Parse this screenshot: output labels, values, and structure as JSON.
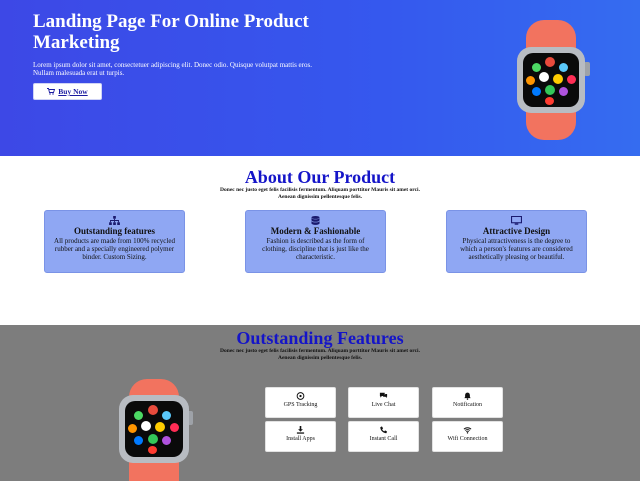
{
  "hero": {
    "title": "Landing Page For Online Product Marketing",
    "text": "Lorem ipsum dolor sit amet, consectetuer adipiscing elit. Donec odio. Quisque volutpat mattis eros. Nullam malesuada erat ut turpis.",
    "buy_label": "Buy Now",
    "buy_icon": "cart-icon"
  },
  "about": {
    "title": "About Our Product",
    "subtitle": "Donec nec justo eget felis facilisis fermentum. Aliquam porttitor Mauris sit amet orci. Aenean dignissim pellentesque felis.",
    "cards": [
      {
        "icon": "sitemap-icon",
        "title": "Outstanding features",
        "text": "All products are made from 100% recycled rubber and a specially engineered polymer binder. Custom Sizing."
      },
      {
        "icon": "database-icon",
        "title": "Modern & Fashionable",
        "text": "Fashion is described as the form of clothing, discipline that is just like the characteristic."
      },
      {
        "icon": "monitor-icon",
        "title": "Attractive Design",
        "text": "Physical attractiveness is the degree to which a person's features are considered aesthetically pleasing or beautiful."
      }
    ]
  },
  "features": {
    "title": "Outstanding Features",
    "subtitle": "Donec nec justo eget felis facilisis fermentum. Aliquam porttitor Mauris sit amet orci. Aenean dignissim pellentesque felis.",
    "items": [
      {
        "icon": "compass-icon",
        "label": "GPS  Tracking"
      },
      {
        "icon": "chat-icon",
        "label": "Live  Chat"
      },
      {
        "icon": "bell-icon",
        "label": "Notification"
      },
      {
        "icon": "download-icon",
        "label": "Install Apps"
      },
      {
        "icon": "phone-icon",
        "label": "Instant Call"
      },
      {
        "icon": "wifi-icon",
        "label": "Wifi Connection"
      }
    ]
  },
  "colors": {
    "hero_gradient_start": "#3d48e6",
    "hero_gradient_end": "#356cf0",
    "heading_blue": "#1414c8",
    "card_bg": "#8fa7f3",
    "features_bg": "#7d7d7d",
    "watch_band": "#f2735f"
  }
}
